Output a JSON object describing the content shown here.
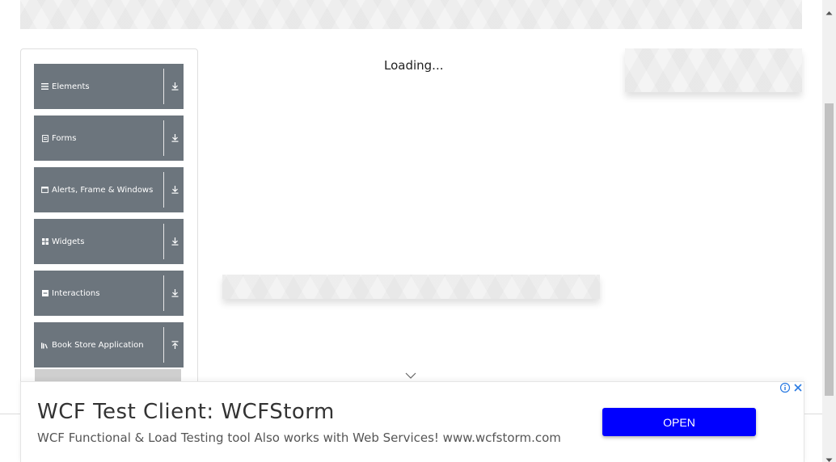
{
  "main": {
    "loading_text": "Loading..."
  },
  "sidebar": {
    "groups": [
      {
        "label": "Elements",
        "icon": "hamburger-icon",
        "arrow": "download-arrow-icon"
      },
      {
        "label": "Forms",
        "icon": "form-icon",
        "arrow": "download-arrow-icon"
      },
      {
        "label": "Alerts, Frame & Windows",
        "icon": "window-icon",
        "arrow": "download-arrow-icon"
      },
      {
        "label": "Widgets",
        "icon": "grid-icon",
        "arrow": "download-arrow-icon"
      },
      {
        "label": "Interactions",
        "icon": "list-box-icon",
        "arrow": "download-arrow-icon"
      },
      {
        "label": "Book Store Application",
        "icon": "books-icon",
        "arrow": "upload-arrow-icon"
      }
    ]
  },
  "bottom_ad": {
    "title": "WCF Test Client: WCFStorm",
    "description": "WCF Functional & Load Testing tool Also works with Web Services! www.wcfstorm.com",
    "cta_label": "OPEN"
  },
  "colors": {
    "menu_bg": "#6c757d",
    "cta_bg": "#0000ff",
    "adchoices_blue": "#2a7ae2"
  }
}
